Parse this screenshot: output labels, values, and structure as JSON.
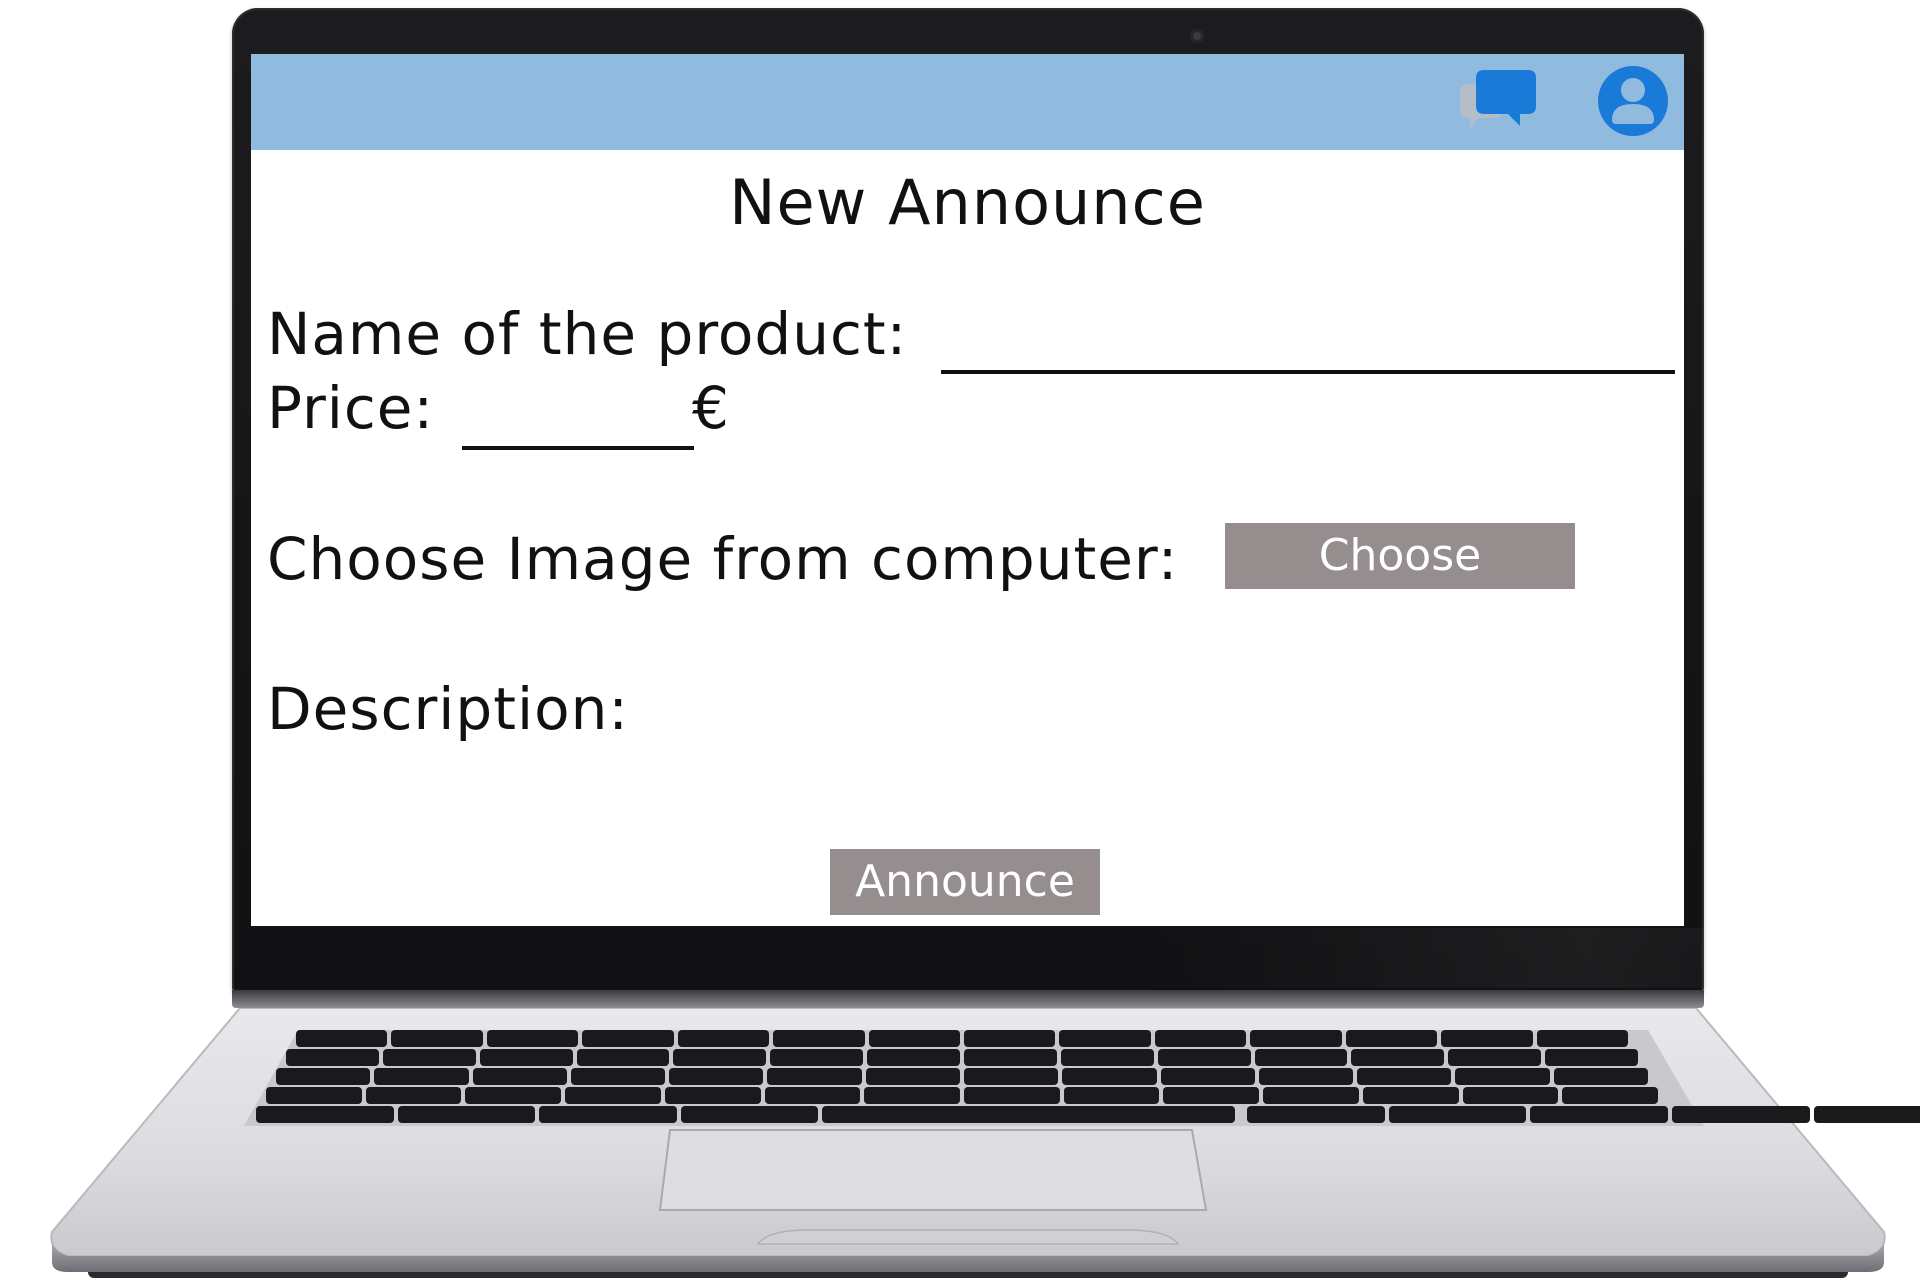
{
  "app": {
    "title": "New Announce",
    "accent_color": "#91badf",
    "icon_color": "#1a7ad8",
    "button_color": "#958d8e"
  },
  "header": {
    "icons": [
      "chat-icon",
      "profile-icon"
    ]
  },
  "form": {
    "product_name": {
      "label": "Name of the product:",
      "value": ""
    },
    "price": {
      "label": "Price:",
      "value": "",
      "currency": "€"
    },
    "image": {
      "label": "Choose Image from computer:",
      "button_label": "Choose"
    },
    "description": {
      "label": "Description:",
      "value": ""
    },
    "submit_label": "Announce"
  }
}
